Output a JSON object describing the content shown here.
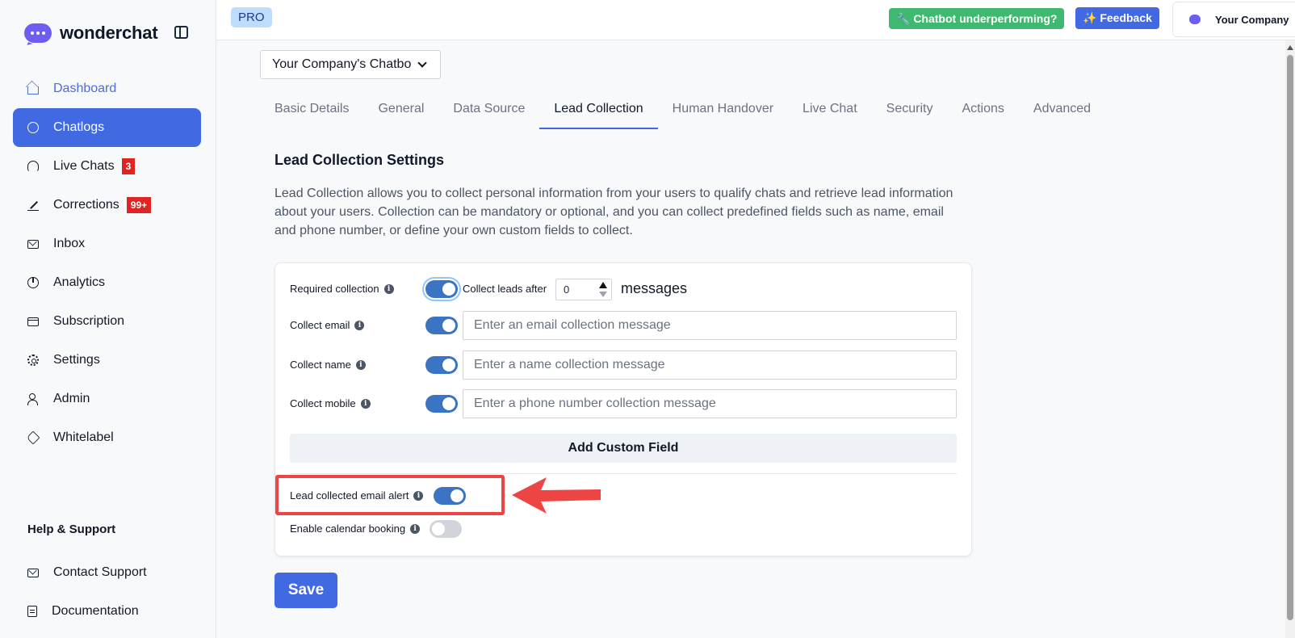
{
  "brand": {
    "name": "wonderchat"
  },
  "sidebar": {
    "items": [
      {
        "label": "Dashboard",
        "icon": "home-icon"
      },
      {
        "label": "Chatlogs",
        "icon": "chat-icon"
      },
      {
        "label": "Live Chats",
        "icon": "headset-icon",
        "badge": "3"
      },
      {
        "label": "Corrections",
        "icon": "pen-icon",
        "badge": "99+"
      },
      {
        "label": "Inbox",
        "icon": "mail-icon"
      },
      {
        "label": "Analytics",
        "icon": "pie-chart-icon"
      },
      {
        "label": "Subscription",
        "icon": "credit-card-icon"
      },
      {
        "label": "Settings",
        "icon": "gear-icon"
      },
      {
        "label": "Admin",
        "icon": "user-icon"
      },
      {
        "label": "Whitelabel",
        "icon": "tag-icon"
      }
    ],
    "help_title": "Help & Support",
    "help_items": [
      {
        "label": "Contact Support",
        "icon": "mail-icon"
      },
      {
        "label": "Documentation",
        "icon": "document-icon"
      }
    ]
  },
  "topbar": {
    "plan": "PRO",
    "underperforming": "🔧 Chatbot underperforming?",
    "feedback": "✨ Feedback",
    "company": "Your Company"
  },
  "bot_select": {
    "value": "Your Company's Chatbot"
  },
  "tabs": [
    {
      "label": "Basic Details"
    },
    {
      "label": "General"
    },
    {
      "label": "Data Source"
    },
    {
      "label": "Lead Collection",
      "active": true
    },
    {
      "label": "Human Handover"
    },
    {
      "label": "Live Chat"
    },
    {
      "label": "Security"
    },
    {
      "label": "Actions"
    },
    {
      "label": "Advanced"
    }
  ],
  "lead": {
    "title": "Lead Collection Settings",
    "description": "Lead Collection allows you to collect personal information from your users to qualify chats and retrieve lead information about your users. Collection can be mandatory or optional, and you can collect predefined fields such as name, email and phone number, or define your own custom fields to collect.",
    "required_label": "Required collection",
    "collect_after_label": "Collect leads after",
    "collect_after_value": "0",
    "messages_label": "messages",
    "email_label": "Collect email",
    "email_placeholder": "Enter an email collection message",
    "name_label": "Collect name",
    "name_placeholder": "Enter a name collection message",
    "mobile_label": "Collect mobile",
    "mobile_placeholder": "Enter a phone number collection message",
    "add_custom_field": "Add Custom Field",
    "email_alert_label": "Lead collected email alert",
    "calendar_label": "Enable calendar booking",
    "info_glyph": "i",
    "toggles": {
      "required": true,
      "email": true,
      "name": true,
      "mobile": true,
      "email_alert": true,
      "calendar": false
    }
  },
  "save_label": "Save",
  "colors": {
    "primary": "#4169e1",
    "success": "#3fb870",
    "highlight": "#ef4444",
    "badge": "#e02424"
  }
}
